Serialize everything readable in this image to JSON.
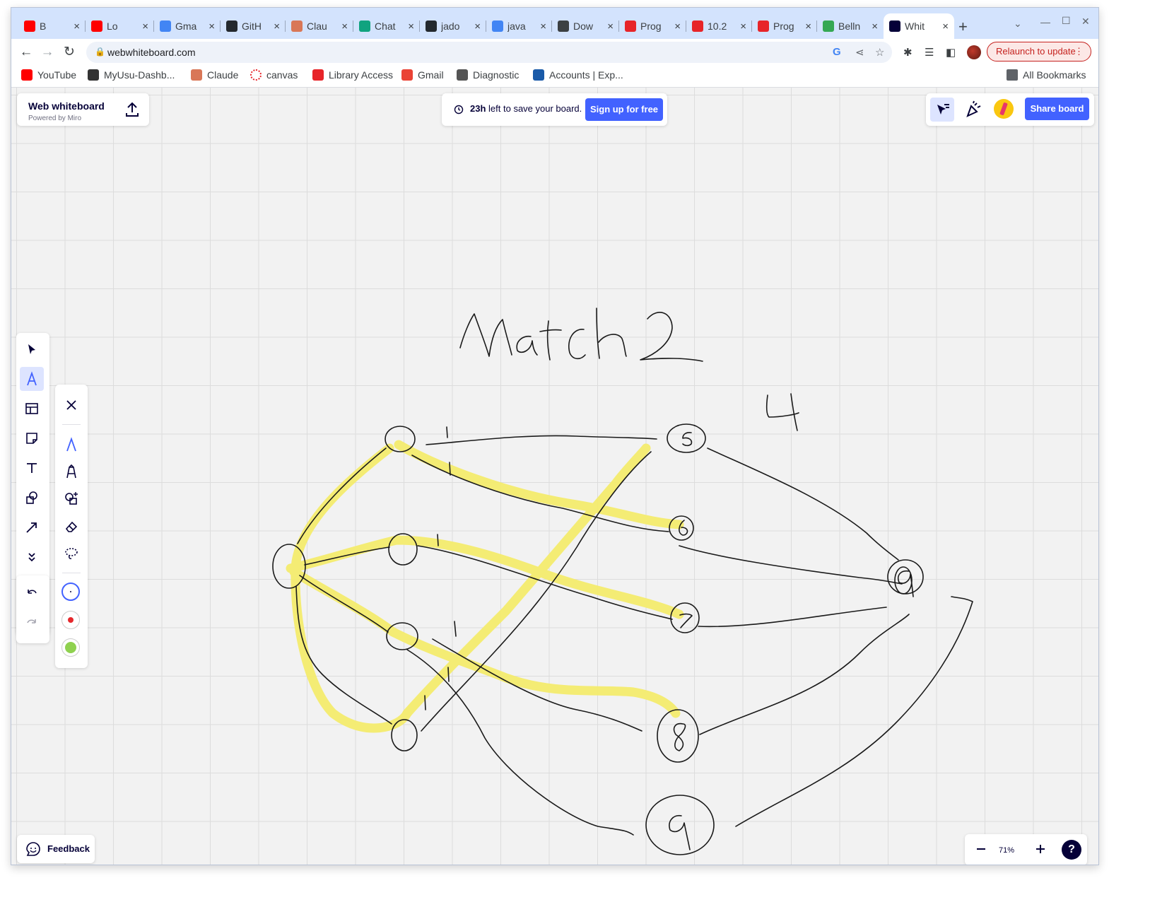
{
  "browser": {
    "tabs": [
      {
        "title": "B",
        "icon": "youtube-icon",
        "color": "#ff0000"
      },
      {
        "title": "Lo",
        "icon": "youtube-icon",
        "color": "#ff0000"
      },
      {
        "title": "Gma",
        "icon": "google-icon",
        "color": "#4285f4"
      },
      {
        "title": "GitH",
        "icon": "github-icon",
        "color": "#24292e"
      },
      {
        "title": "Clau",
        "icon": "claude-icon",
        "color": "#d97757"
      },
      {
        "title": "Chat",
        "icon": "chatgpt-icon",
        "color": "#10a37f"
      },
      {
        "title": "jado",
        "icon": "github-icon",
        "color": "#24292e"
      },
      {
        "title": "java",
        "icon": "google-icon",
        "color": "#4285f4"
      },
      {
        "title": "Dow",
        "icon": "download-icon",
        "color": "#3c4043"
      },
      {
        "title": "Prog",
        "icon": "canvas-icon",
        "color": "#e72429"
      },
      {
        "title": "10.2",
        "icon": "canvas-icon",
        "color": "#e72429"
      },
      {
        "title": "Prog",
        "icon": "canvas-icon",
        "color": "#e72429"
      },
      {
        "title": "Belln",
        "icon": "bellman-icon",
        "color": "#34a853"
      },
      {
        "title": "Whit",
        "icon": "whiteboard-icon",
        "color": "#050038"
      }
    ],
    "url": "webwhiteboard.com",
    "relaunch_label": "Relaunch to update",
    "bookmarks": [
      {
        "label": "YouTube",
        "icon": "youtube-icon"
      },
      {
        "label": "MyUsu-Dashb...",
        "icon": "usu-icon"
      },
      {
        "label": "Claude",
        "icon": "claude-icon"
      },
      {
        "label": "canvas",
        "icon": "canvas-icon"
      },
      {
        "label": "Library Access",
        "icon": "library-icon"
      },
      {
        "label": "Gmail",
        "icon": "gmail-icon"
      },
      {
        "label": "Diagnostic",
        "icon": "apple-icon"
      },
      {
        "label": "Accounts | Exp...",
        "icon": "rs-icon"
      }
    ],
    "all_bookmarks_label": "All Bookmarks"
  },
  "whiteboard": {
    "brand_title": "Web whiteboard",
    "brand_sub": "Powered by Miro",
    "save_hours": "23h",
    "save_text": "left to save your board.",
    "signup_label": "Sign up for free",
    "share_label": "Share board",
    "zoom": "71%",
    "feedback_label": "Feedback",
    "accent": "#4262ff",
    "highlight_color": "#f5ec6e"
  },
  "drawing": {
    "title": "Match 2",
    "edge_marks": [
      "1",
      "1",
      "1",
      "1",
      "1",
      "1"
    ],
    "node_labels": [
      "5",
      "6",
      "7",
      "8",
      "9",
      "9"
    ],
    "note": "4"
  }
}
